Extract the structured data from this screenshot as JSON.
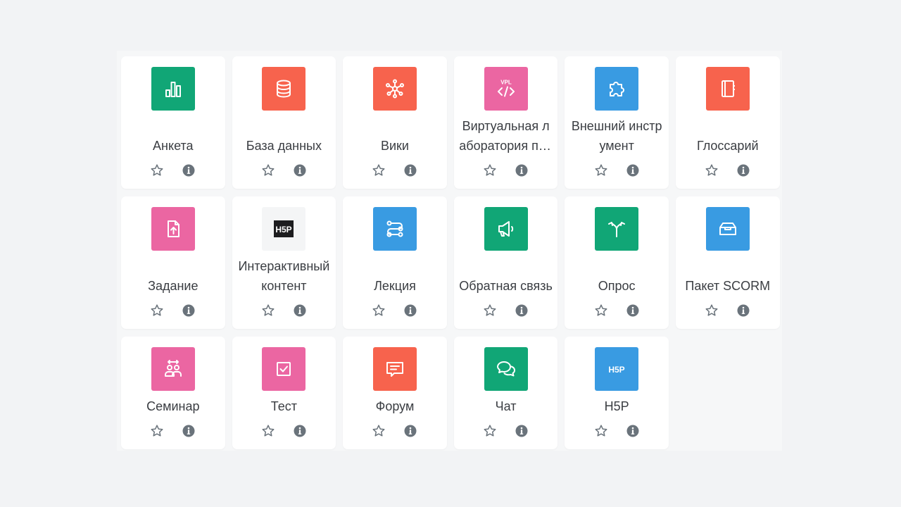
{
  "colors": {
    "assessment": "#11a676",
    "collaboration": "#f7634d",
    "interactive": "#399be2",
    "administration": "#eb66a2",
    "h5p_bg": "#f4f5f6",
    "text": "#3a3d42",
    "action": "#6a737b"
  },
  "activities": [
    {
      "label": "Анкета",
      "icon": "bar-chart-icon",
      "color": "#11a676"
    },
    {
      "label": "База данных",
      "icon": "database-icon",
      "color": "#f7634d"
    },
    {
      "label": "Вики",
      "icon": "network-icon",
      "color": "#f7634d"
    },
    {
      "label": "Виртуальная лаборатория программирования",
      "icon": "vpl-code-icon",
      "color": "#eb66a2"
    },
    {
      "label": "Внешний инструмент",
      "icon": "puzzle-icon",
      "color": "#399be2"
    },
    {
      "label": "Глоссарий",
      "icon": "notebook-icon",
      "color": "#f7634d"
    },
    {
      "label": "Задание",
      "icon": "file-upload-icon",
      "color": "#eb66a2"
    },
    {
      "label": "Интерактивный контент",
      "icon": "h5p-logo-dark-icon",
      "color": "#f4f5f6"
    },
    {
      "label": "Лекция",
      "icon": "route-icon",
      "color": "#399be2"
    },
    {
      "label": "Обратная связь",
      "icon": "megaphone-icon",
      "color": "#11a676"
    },
    {
      "label": "Опрос",
      "icon": "signpost-icon",
      "color": "#11a676"
    },
    {
      "label": "Пакет SCORM",
      "icon": "package-icon",
      "color": "#399be2"
    },
    {
      "label": "Семинар",
      "icon": "people-exchange-icon",
      "color": "#eb66a2"
    },
    {
      "label": "Тест",
      "icon": "checkbox-icon",
      "color": "#eb66a2"
    },
    {
      "label": "Форум",
      "icon": "chat-bubble-icon",
      "color": "#f7634d"
    },
    {
      "label": "Чат",
      "icon": "chat-bubbles-icon",
      "color": "#11a676"
    },
    {
      "label": "H5P",
      "icon": "h5p-logo-icon",
      "color": "#399be2"
    }
  ]
}
